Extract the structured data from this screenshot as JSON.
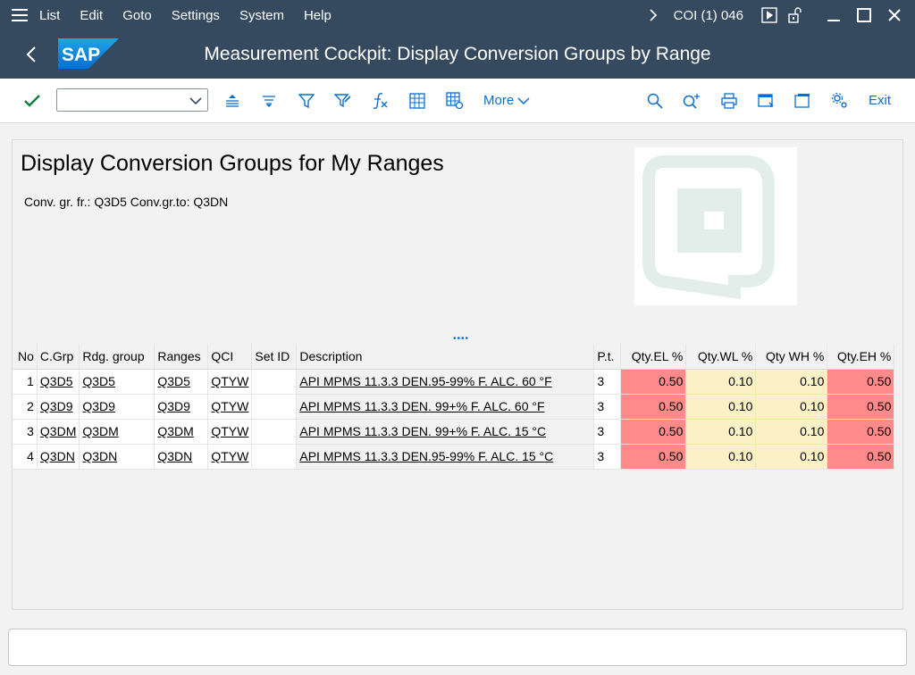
{
  "menu": {
    "items": [
      "List",
      "Edit",
      "Goto",
      "Settings",
      "System",
      "Help"
    ],
    "system_info": "COI (1) 046"
  },
  "titlebar": {
    "logo_text": "SAP",
    "title": "Measurement Cockpit: Display Conversion Groups by Range"
  },
  "toolbar": {
    "command_field_value": "",
    "more_label": "More",
    "exit_label": "Exit"
  },
  "report": {
    "title": "Display Conversion Groups for My Ranges",
    "subtitle": "Conv. gr. fr.: Q3D5 Conv.gr.to: Q3DN"
  },
  "splitter_glyph": "••••",
  "table": {
    "columns": [
      "No",
      "C.Grp",
      "Rdg. group",
      "Ranges",
      "QCI",
      "Set ID",
      "Description",
      "P.t.",
      "Qty.EL %",
      "Qty.WL %",
      "Qty WH %",
      "Qty.EH %"
    ],
    "rows": [
      {
        "no": "1",
        "cgrp": "Q3D5",
        "rdg": "Q3D5",
        "ranges": "Q3D5",
        "qci": "QTYW",
        "setid": "",
        "desc": "API MPMS 11.3.3 DEN.95-99% F. ALC. 60 °F",
        "pt": "3",
        "el": "0.50",
        "wl": "0.10",
        "wh": "0.10",
        "eh": "0.50"
      },
      {
        "no": "2",
        "cgrp": "Q3D9",
        "rdg": "Q3D9",
        "ranges": "Q3D9",
        "qci": "QTYW",
        "setid": "",
        "desc": "API MPMS 11.3.3 DEN. 99+% F. ALC. 60 °F",
        "pt": "3",
        "el": "0.50",
        "wl": "0.10",
        "wh": "0.10",
        "eh": "0.50"
      },
      {
        "no": "3",
        "cgrp": "Q3DM",
        "rdg": "Q3DM",
        "ranges": "Q3DM",
        "qci": "QTYW",
        "setid": "",
        "desc": "API MPMS 11.3.3 DEN. 99+% F. ALC. 15 °C",
        "pt": "3",
        "el": "0.50",
        "wl": "0.10",
        "wh": "0.10",
        "eh": "0.50"
      },
      {
        "no": "4",
        "cgrp": "Q3DN",
        "rdg": "Q3DN",
        "ranges": "Q3DN",
        "qci": "QTYW",
        "setid": "",
        "desc": "API MPMS 11.3.3 DEN.95-99% F. ALC. 15 °C",
        "pt": "3",
        "el": "0.50",
        "wl": "0.10",
        "wh": "0.10",
        "eh": "0.50"
      }
    ]
  },
  "colors": {
    "shell": "#354a5f",
    "accent": "#0a6ed1",
    "error_cell": "#ff8a8a",
    "warning_cell": "#fcf0c6",
    "confirm": "#107e3e"
  },
  "statusbar": {
    "message": ""
  }
}
